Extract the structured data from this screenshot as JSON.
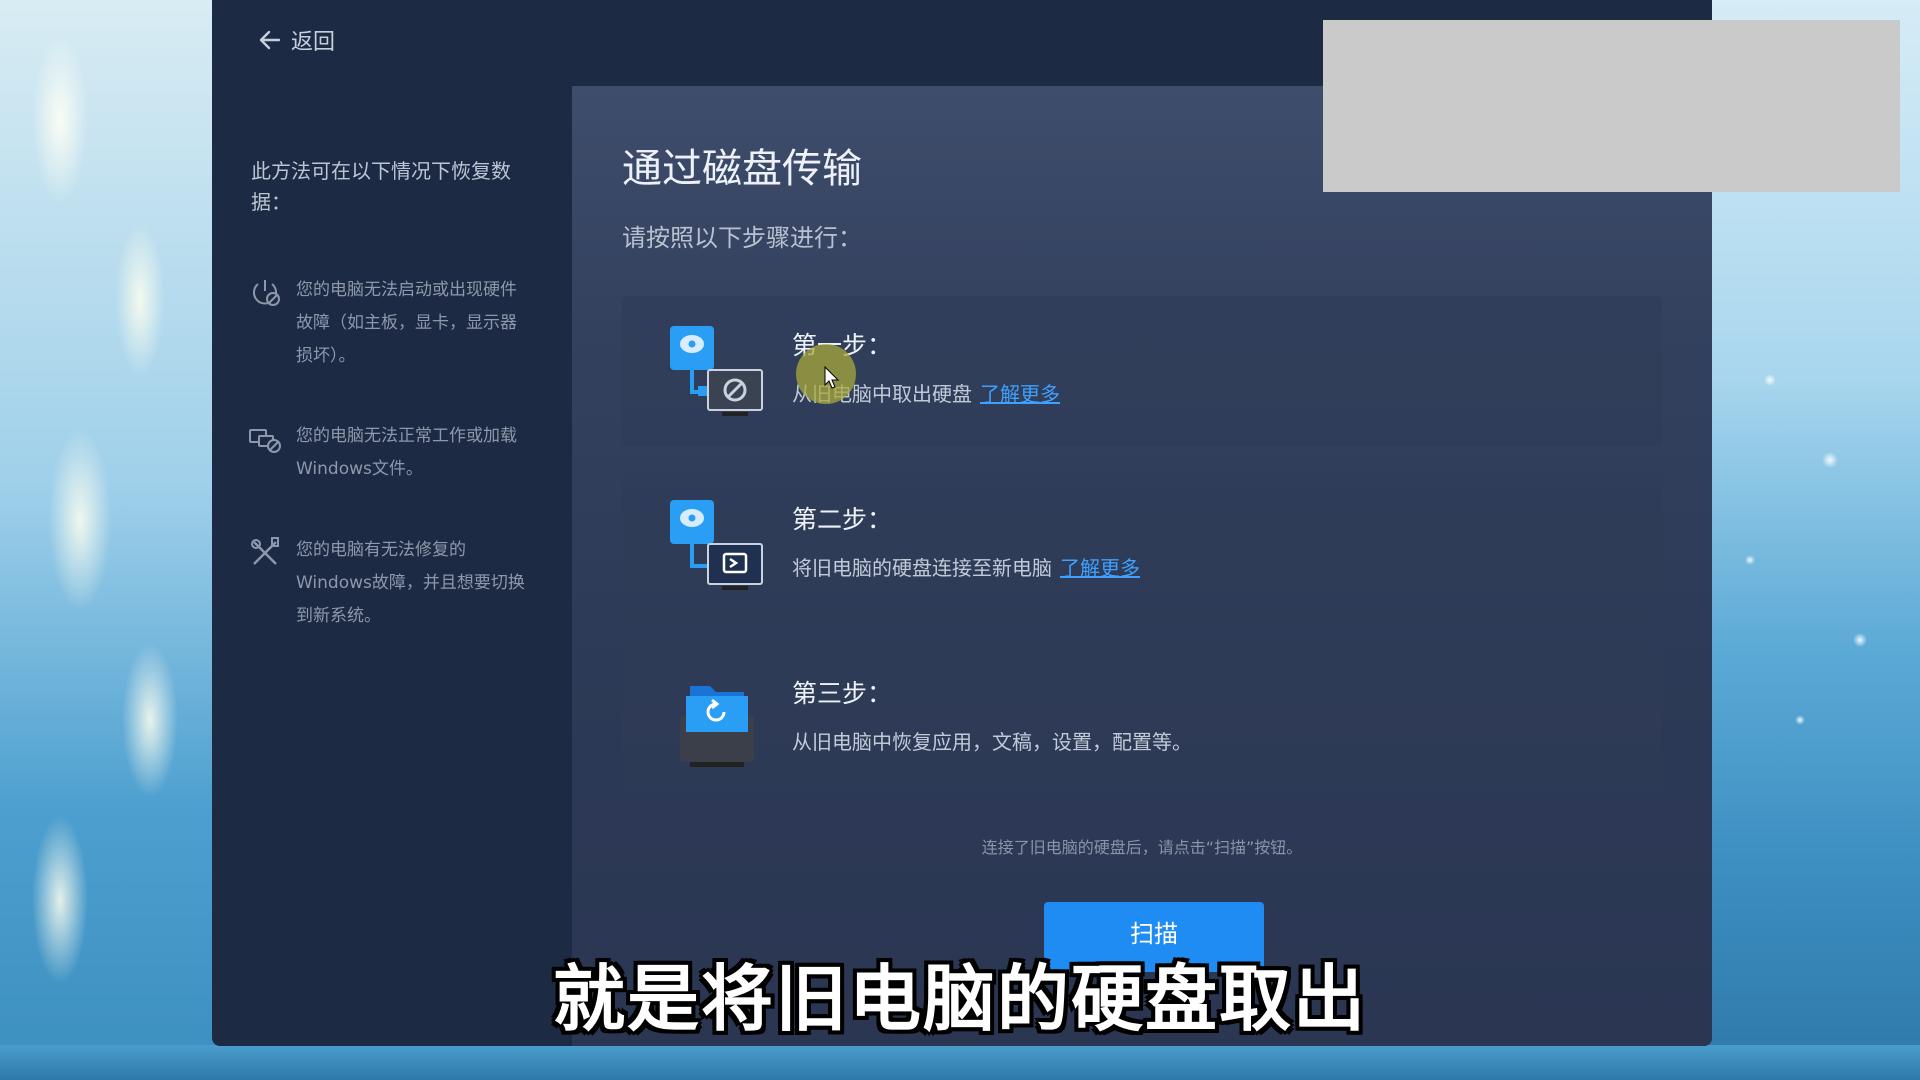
{
  "header": {
    "back_label": "返回"
  },
  "sidebar": {
    "title": "此方法可在以下情况下恢复数据：",
    "conditions": [
      {
        "icon": "power-broken-icon",
        "text": "您的电脑无法启动或出现硬件故障（如主板，显卡，显示器损坏）。"
      },
      {
        "icon": "devices-broken-icon",
        "text": "您的电脑无法正常工作或加载Windows文件。"
      },
      {
        "icon": "tools-icon",
        "text": "您的电脑有无法修复的Windows故障，并且想要切换到新系统。"
      }
    ]
  },
  "main": {
    "title": "通过磁盘传输",
    "subtitle": "请按照以下步骤进行：",
    "steps": [
      {
        "label": "第一步：",
        "desc": "从旧电脑中取出硬盘",
        "link": "了解更多",
        "icon": "disk-remove-icon"
      },
      {
        "label": "第二步：",
        "desc": "将旧电脑的硬盘连接至新电脑",
        "link": "了解更多",
        "icon": "disk-connect-icon"
      },
      {
        "label": "第三步：",
        "desc": "从旧电脑中恢复应用，文稿，设置，配置等。",
        "link": "",
        "icon": "folder-restore-icon"
      }
    ],
    "hint": "连接了旧电脑的硬盘后，请点击“扫描”按钮。",
    "scan_label": "扫描"
  },
  "overlay": {
    "subtitle": "就是将旧电脑的硬盘取出"
  },
  "colors": {
    "accent": "#1e8cf2",
    "link": "#3ea0ff",
    "window_bg": "#1d2a44"
  }
}
